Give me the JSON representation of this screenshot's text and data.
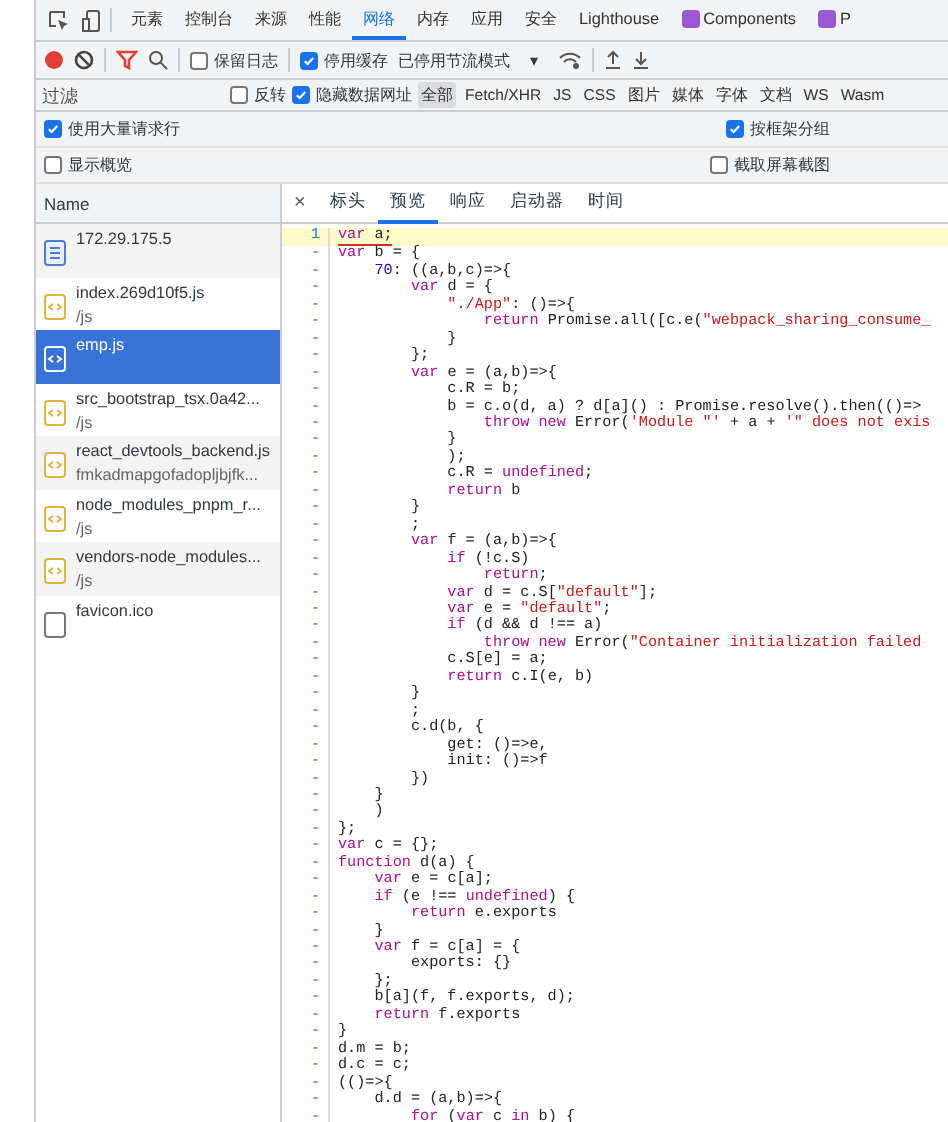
{
  "top_tabs": [
    {
      "label": "元素",
      "selected": false,
      "kind": "text"
    },
    {
      "label": "控制台",
      "selected": false,
      "kind": "text"
    },
    {
      "label": "来源",
      "selected": false,
      "kind": "text"
    },
    {
      "label": "性能",
      "selected": false,
      "kind": "text"
    },
    {
      "label": "网络",
      "selected": true,
      "kind": "text"
    },
    {
      "label": "内存",
      "selected": false,
      "kind": "text"
    },
    {
      "label": "应用",
      "selected": false,
      "kind": "text"
    },
    {
      "label": "安全",
      "selected": false,
      "kind": "text"
    },
    {
      "label": "Lighthouse",
      "selected": false,
      "kind": "text"
    },
    {
      "label": "Components",
      "selected": false,
      "kind": "extension"
    },
    {
      "label": "P",
      "selected": false,
      "kind": "extension"
    }
  ],
  "toolbar": {
    "recording": true,
    "filter_active": true,
    "preserve_log": {
      "label": "保留日志",
      "checked": false
    },
    "disable_cache": {
      "label": "停用缓存",
      "checked": true
    },
    "throttling": "已停用节流模式",
    "dropdown_caret": "▾"
  },
  "filter_row": {
    "placeholder": "过滤",
    "invert": {
      "label": "反转",
      "checked": false
    },
    "hide_data_urls": {
      "label": "隐藏数据网址",
      "checked": true
    },
    "types": [
      {
        "label": "全部",
        "selected": true
      },
      {
        "label": "Fetch/XHR",
        "selected": false
      },
      {
        "label": "JS",
        "selected": false
      },
      {
        "label": "CSS",
        "selected": false
      },
      {
        "label": "图片",
        "selected": false
      },
      {
        "label": "媒体",
        "selected": false
      },
      {
        "label": "字体",
        "selected": false
      },
      {
        "label": "文档",
        "selected": false
      },
      {
        "label": "WS",
        "selected": false
      },
      {
        "label": "Wasm",
        "selected": false
      }
    ]
  },
  "options": [
    {
      "left": {
        "label": "使用大量请求行",
        "checked": true
      },
      "right": {
        "label": "按框架分组",
        "checked": true
      }
    },
    {
      "left": {
        "label": "显示概览",
        "checked": false
      },
      "right": {
        "label": "截取屏幕截图",
        "checked": false
      }
    }
  ],
  "requests": {
    "column": "Name",
    "items": [
      {
        "name": "172.29.175.5",
        "kind": "document",
        "selected": false
      },
      {
        "name": "index.269d10f5.js",
        "path": "/js",
        "kind": "script",
        "selected": false
      },
      {
        "name": "emp.js",
        "kind": "script",
        "selected": true
      },
      {
        "name": "src_bootstrap_tsx.0a42...",
        "path": "/js",
        "kind": "script",
        "selected": false
      },
      {
        "name": "react_devtools_backend.js",
        "path": "fmkadmapgofadopljbjfk...",
        "kind": "script",
        "selected": false
      },
      {
        "name": "node_modules_pnpm_r...",
        "path": "/js",
        "kind": "script",
        "selected": false
      },
      {
        "name": "vendors-node_modules...",
        "path": "/js",
        "kind": "script",
        "selected": false
      },
      {
        "name": "favicon.ico",
        "kind": "other",
        "selected": false
      }
    ]
  },
  "detail": {
    "close": "×",
    "tabs": [
      {
        "label": "标头",
        "selected": false
      },
      {
        "label": "预览",
        "selected": true
      },
      {
        "label": "响应",
        "selected": false
      },
      {
        "label": "启动器",
        "selected": false
      },
      {
        "label": "时间",
        "selected": false
      }
    ],
    "lines": [
      {
        "no": "1",
        "highlighted": true,
        "segments": [
          {
            "kind": "keyword",
            "text": "var"
          },
          {
            "kind": "plain",
            "text": " a;"
          }
        ]
      },
      {
        "no": "-",
        "highlighted": false,
        "segments": [
          {
            "kind": "keyword",
            "text": "var"
          },
          {
            "kind": "plain",
            "text": " b = {"
          }
        ]
      },
      {
        "no": "-",
        "highlighted": false,
        "segments": [
          {
            "kind": "number",
            "text": "    70"
          },
          {
            "kind": "plain",
            "text": ": ((a,b,c)=>{"
          }
        ]
      },
      {
        "no": "-",
        "highlighted": false,
        "segments": [
          {
            "kind": "keyword",
            "text": "        var"
          },
          {
            "kind": "plain",
            "text": " d = {"
          }
        ]
      },
      {
        "no": "-",
        "highlighted": false,
        "segments": [
          {
            "kind": "string",
            "text": "            \"./App\""
          },
          {
            "kind": "plain",
            "text": ": ()=>{"
          }
        ]
      },
      {
        "no": "-",
        "highlighted": false,
        "segments": [
          {
            "kind": "keyword",
            "text": "                return"
          },
          {
            "kind": "plain",
            "text": " Promise.all([c.e("
          },
          {
            "kind": "string",
            "text": "\"webpack_sharing_consume_"
          }
        ]
      },
      {
        "no": "-",
        "highlighted": false,
        "segments": [
          {
            "kind": "plain",
            "text": "            }"
          }
        ]
      },
      {
        "no": "-",
        "highlighted": false,
        "segments": [
          {
            "kind": "plain",
            "text": "        };"
          }
        ]
      },
      {
        "no": "-",
        "highlighted": false,
        "segments": [
          {
            "kind": "keyword",
            "text": "        var"
          },
          {
            "kind": "plain",
            "text": " e = (a,b)=>{"
          }
        ]
      },
      {
        "no": "-",
        "highlighted": false,
        "segments": [
          {
            "kind": "plain",
            "text": "            c.R = b;"
          }
        ]
      },
      {
        "no": "-",
        "highlighted": false,
        "segments": [
          {
            "kind": "plain",
            "text": "            b = c.o(d, a) ? d[a]() : Promise.resolve().then(()=>"
          }
        ]
      },
      {
        "no": "-",
        "highlighted": false,
        "segments": [
          {
            "kind": "keyword",
            "text": "                throw new"
          },
          {
            "kind": "plain",
            "text": " Error("
          },
          {
            "kind": "string",
            "text": "'Module \"'"
          },
          {
            "kind": "plain",
            "text": " + a + "
          },
          {
            "kind": "string",
            "text": "'\" does not exis"
          }
        ]
      },
      {
        "no": "-",
        "highlighted": false,
        "segments": [
          {
            "kind": "plain",
            "text": "            }"
          }
        ]
      },
      {
        "no": "-",
        "highlighted": false,
        "segments": [
          {
            "kind": "plain",
            "text": "            );"
          }
        ]
      },
      {
        "no": "-",
        "highlighted": false,
        "segments": [
          {
            "kind": "plain",
            "text": "            c.R = "
          },
          {
            "kind": "keyword",
            "text": "undefined"
          },
          {
            "kind": "plain",
            "text": ";"
          }
        ]
      },
      {
        "no": "-",
        "highlighted": false,
        "segments": [
          {
            "kind": "keyword",
            "text": "            return"
          },
          {
            "kind": "plain",
            "text": " b"
          }
        ]
      },
      {
        "no": "-",
        "highlighted": false,
        "segments": [
          {
            "kind": "plain",
            "text": "        }"
          }
        ]
      },
      {
        "no": "-",
        "highlighted": false,
        "segments": [
          {
            "kind": "plain",
            "text": "        ;"
          }
        ]
      },
      {
        "no": "-",
        "highlighted": false,
        "segments": [
          {
            "kind": "keyword",
            "text": "        var"
          },
          {
            "kind": "plain",
            "text": " f = (a,b)=>{"
          }
        ]
      },
      {
        "no": "-",
        "highlighted": false,
        "segments": [
          {
            "kind": "keyword",
            "text": "            if"
          },
          {
            "kind": "plain",
            "text": " (!c.S)"
          }
        ]
      },
      {
        "no": "-",
        "highlighted": false,
        "segments": [
          {
            "kind": "keyword",
            "text": "                return"
          },
          {
            "kind": "plain",
            "text": ";"
          }
        ]
      },
      {
        "no": "-",
        "highlighted": false,
        "segments": [
          {
            "kind": "keyword",
            "text": "            var"
          },
          {
            "kind": "plain",
            "text": " d = c.S["
          },
          {
            "kind": "string",
            "text": "\"default\""
          },
          {
            "kind": "plain",
            "text": "];"
          }
        ]
      },
      {
        "no": "-",
        "highlighted": false,
        "segments": [
          {
            "kind": "keyword",
            "text": "            var"
          },
          {
            "kind": "plain",
            "text": " e = "
          },
          {
            "kind": "string",
            "text": "\"default\""
          },
          {
            "kind": "plain",
            "text": ";"
          }
        ]
      },
      {
        "no": "-",
        "highlighted": false,
        "segments": [
          {
            "kind": "keyword",
            "text": "            if"
          },
          {
            "kind": "plain",
            "text": " (d && d !== a)"
          }
        ]
      },
      {
        "no": "-",
        "highlighted": false,
        "segments": [
          {
            "kind": "keyword",
            "text": "                throw new"
          },
          {
            "kind": "plain",
            "text": " Error("
          },
          {
            "kind": "string",
            "text": "\"Container initialization failed"
          }
        ]
      },
      {
        "no": "-",
        "highlighted": false,
        "segments": [
          {
            "kind": "plain",
            "text": "            c.S[e] = a;"
          }
        ]
      },
      {
        "no": "-",
        "highlighted": false,
        "segments": [
          {
            "kind": "keyword",
            "text": "            return"
          },
          {
            "kind": "plain",
            "text": " c.I(e, b)"
          }
        ]
      },
      {
        "no": "-",
        "highlighted": false,
        "segments": [
          {
            "kind": "plain",
            "text": "        }"
          }
        ]
      },
      {
        "no": "-",
        "highlighted": false,
        "segments": [
          {
            "kind": "plain",
            "text": "        ;"
          }
        ]
      },
      {
        "no": "-",
        "highlighted": false,
        "segments": [
          {
            "kind": "plain",
            "text": "        c.d(b, {"
          }
        ]
      },
      {
        "no": "-",
        "highlighted": false,
        "segments": [
          {
            "kind": "plain",
            "text": "            get: ()=>e,"
          }
        ]
      },
      {
        "no": "-",
        "highlighted": false,
        "segments": [
          {
            "kind": "plain",
            "text": "            init: ()=>f"
          }
        ]
      },
      {
        "no": "-",
        "highlighted": false,
        "segments": [
          {
            "kind": "plain",
            "text": "        })"
          }
        ]
      },
      {
        "no": "-",
        "highlighted": false,
        "segments": [
          {
            "kind": "plain",
            "text": "    }"
          }
        ]
      },
      {
        "no": "-",
        "highlighted": false,
        "segments": [
          {
            "kind": "plain",
            "text": "    )"
          }
        ]
      },
      {
        "no": "-",
        "highlighted": false,
        "segments": [
          {
            "kind": "plain",
            "text": "};"
          }
        ]
      },
      {
        "no": "-",
        "highlighted": false,
        "segments": [
          {
            "kind": "keyword",
            "text": "var"
          },
          {
            "kind": "plain",
            "text": " c = {};"
          }
        ]
      },
      {
        "no": "-",
        "highlighted": false,
        "segments": [
          {
            "kind": "keyword",
            "text": "function"
          },
          {
            "kind": "plain",
            "text": " d(a) {"
          }
        ]
      },
      {
        "no": "-",
        "highlighted": false,
        "segments": [
          {
            "kind": "keyword",
            "text": "    var"
          },
          {
            "kind": "plain",
            "text": " e = c[a];"
          }
        ]
      },
      {
        "no": "-",
        "highlighted": false,
        "segments": [
          {
            "kind": "keyword",
            "text": "    if"
          },
          {
            "kind": "plain",
            "text": " (e !== "
          },
          {
            "kind": "keyword",
            "text": "undefined"
          },
          {
            "kind": "plain",
            "text": ") {"
          }
        ]
      },
      {
        "no": "-",
        "highlighted": false,
        "segments": [
          {
            "kind": "keyword",
            "text": "        return"
          },
          {
            "kind": "plain",
            "text": " e.exports"
          }
        ]
      },
      {
        "no": "-",
        "highlighted": false,
        "segments": [
          {
            "kind": "plain",
            "text": "    }"
          }
        ]
      },
      {
        "no": "-",
        "highlighted": false,
        "segments": [
          {
            "kind": "keyword",
            "text": "    var"
          },
          {
            "kind": "plain",
            "text": " f = c[a] = {"
          }
        ]
      },
      {
        "no": "-",
        "highlighted": false,
        "segments": [
          {
            "kind": "plain",
            "text": "        exports: {}"
          }
        ]
      },
      {
        "no": "-",
        "highlighted": false,
        "segments": [
          {
            "kind": "plain",
            "text": "    };"
          }
        ]
      },
      {
        "no": "-",
        "highlighted": false,
        "segments": [
          {
            "kind": "plain",
            "text": "    b[a](f, f.exports, d);"
          }
        ]
      },
      {
        "no": "-",
        "highlighted": false,
        "segments": [
          {
            "kind": "keyword",
            "text": "    return"
          },
          {
            "kind": "plain",
            "text": " f.exports"
          }
        ]
      },
      {
        "no": "-",
        "highlighted": false,
        "segments": [
          {
            "kind": "plain",
            "text": "}"
          }
        ]
      },
      {
        "no": "-",
        "highlighted": false,
        "segments": [
          {
            "kind": "plain",
            "text": "d.m = b;"
          }
        ]
      },
      {
        "no": "-",
        "highlighted": false,
        "segments": [
          {
            "kind": "plain",
            "text": "d.c = c;"
          }
        ]
      },
      {
        "no": "-",
        "highlighted": false,
        "segments": [
          {
            "kind": "plain",
            "text": "(()=>{"
          }
        ]
      },
      {
        "no": "-",
        "highlighted": false,
        "segments": [
          {
            "kind": "plain",
            "text": "    d.d = (a,b)=>{"
          }
        ]
      },
      {
        "no": "-",
        "highlighted": false,
        "segments": [
          {
            "kind": "keyword",
            "text": "        for"
          },
          {
            "kind": "plain",
            "text": " ("
          },
          {
            "kind": "keyword",
            "text": "var"
          },
          {
            "kind": "plain",
            "text": " c "
          },
          {
            "kind": "keyword",
            "text": "in"
          },
          {
            "kind": "plain",
            "text": " b) {"
          }
        ]
      }
    ]
  }
}
